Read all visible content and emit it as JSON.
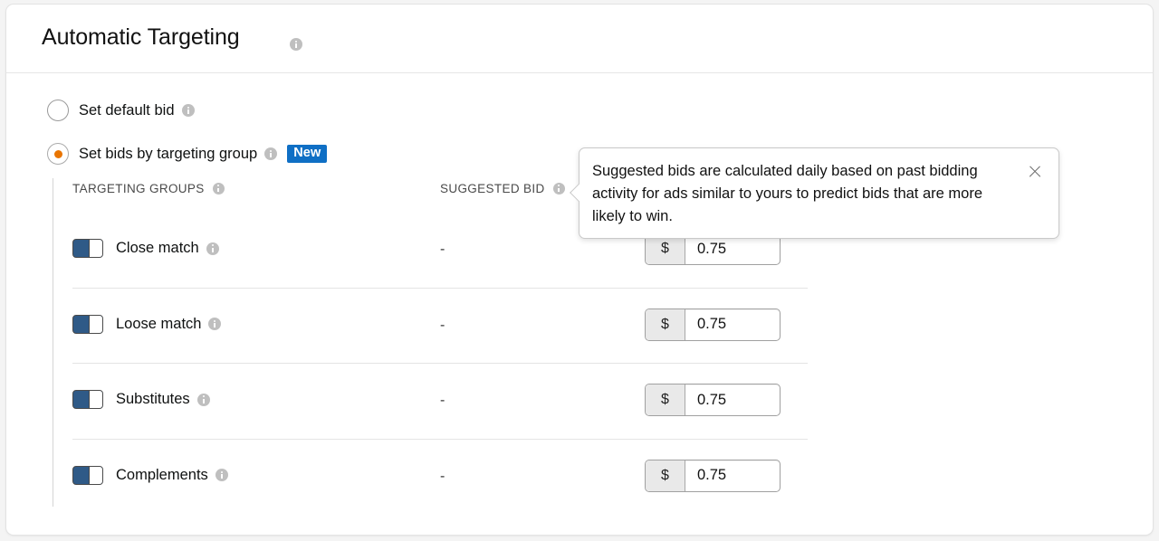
{
  "card": {
    "title": "Automatic Targeting",
    "title_info_icon": "info-icon"
  },
  "bid_mode": {
    "options": [
      {
        "label": "Set default bid",
        "selected": false,
        "info_icon": "info-icon"
      },
      {
        "label": "Set bids by targeting group",
        "selected": true,
        "info_icon": "info-icon",
        "badge": "New"
      }
    ]
  },
  "table": {
    "headers": {
      "targeting_groups": "TARGETING GROUPS",
      "suggested_bid": "SUGGESTED BID"
    },
    "rows": [
      {
        "name": "Close match",
        "enabled": true,
        "suggested_bid": "-",
        "currency": "$",
        "bid": "0.75"
      },
      {
        "name": "Loose match",
        "enabled": true,
        "suggested_bid": "-",
        "currency": "$",
        "bid": "0.75"
      },
      {
        "name": "Substitutes",
        "enabled": true,
        "suggested_bid": "-",
        "currency": "$",
        "bid": "0.75"
      },
      {
        "name": "Complements",
        "enabled": true,
        "suggested_bid": "-",
        "currency": "$",
        "bid": "0.75"
      }
    ]
  },
  "tooltip": {
    "text": "Suggested bids are calculated daily based on past bidding activity for ads similar to yours to predict bids that are more likely to win.",
    "close_icon": "close-icon"
  },
  "colors": {
    "accent_orange": "#e97500",
    "badge_blue": "#0f6fc5",
    "toggle_on": "#2f5a87",
    "page_background": "#f4f4f4",
    "card_background": "#ffffff"
  }
}
